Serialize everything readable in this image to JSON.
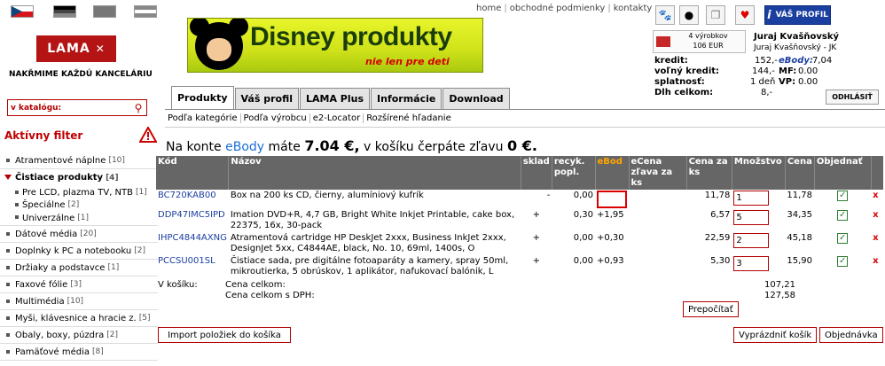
{
  "top_links": [
    "home",
    "obchodné podmienky",
    "kontakty"
  ],
  "tagline": "NAKŘMIME KAŽDÚ KANCELÁRIU",
  "logo_text": "LAMA",
  "banner": {
    "title": "Disney produkty",
    "subtitle": "nie len pre deti"
  },
  "user": {
    "profile_button": "VÁŠ PROFIL",
    "cart_line1": "4 výrobkov",
    "cart_line2": "106 EUR",
    "name": "Juraj Kvašňovský",
    "company": "Juraj Kvašňovský - JK",
    "logout": "ODHLÁSIŤ"
  },
  "account": [
    {
      "label": "kredit:",
      "value": "152,-",
      "label2": "eBody:",
      "value2": "7,04"
    },
    {
      "label": "voľný kredit:",
      "value": "144,-",
      "label2": "MF:",
      "value2": "0.00"
    },
    {
      "label": "splatnosť:",
      "value": "1 deň",
      "label2": "VP:",
      "value2": "0.00"
    },
    {
      "label": "Dlh celkom:",
      "value": "8,-",
      "label2": "",
      "value2": ""
    }
  ],
  "tabs": [
    "Produkty",
    "Váš profil",
    "LAMA Plus",
    "Informácie",
    "Download"
  ],
  "subnav": [
    "Podľa kategórie",
    "Podľa výrobcu",
    "e2-Locator",
    "Rozšírené hľadanie"
  ],
  "search_label": "v katalógu:",
  "filter_heading": "Aktívny filter",
  "categories": [
    {
      "label": "Atramentové náplne",
      "count": "[10]"
    },
    {
      "label": "Čistiace produkty",
      "count": "[4]"
    },
    {
      "label": "Pre LCD, plazma TV, NTB",
      "count": "[1]"
    },
    {
      "label": "Špeciálne",
      "count": "[2]"
    },
    {
      "label": "Univerzálne",
      "count": "[1]"
    },
    {
      "label": "Dátové média",
      "count": "[20]"
    },
    {
      "label": "Doplnky k PC a notebooku",
      "count": "[2]"
    },
    {
      "label": "Držiaky a podstavce",
      "count": "[1]"
    },
    {
      "label": "Faxové fólie",
      "count": "[3]"
    },
    {
      "label": "Multimédia",
      "count": "[10]"
    },
    {
      "label": "Myši, klávesnice a hracie z.",
      "count": "[5]"
    },
    {
      "label": "Obaly, boxy, púzdra",
      "count": "[2]"
    },
    {
      "label": "Pamäťové média",
      "count": "[8]"
    }
  ],
  "econto": {
    "pre": "Na konte",
    "brand": "eBody",
    "mid": "máte",
    "amount": "7.04 €,",
    "post": "v košíku čerpáte zľavu",
    "discount": "0 €."
  },
  "columns": [
    "Kód",
    "Názov",
    "sklad",
    "recyk. popl.",
    "eBod",
    "eCena zľava za ks",
    "Cena za ks",
    "Množstvo",
    "Cena",
    "Objednať"
  ],
  "rows": [
    {
      "code": "BC720KAB00",
      "name": "Box na 200 ks CD, čierny, alumíniový kufrík",
      "stock": "-",
      "recycle": "0,00",
      "ebod": "",
      "price": "11,78",
      "qty": "1",
      "total": "11,78"
    },
    {
      "code": "DDP47IMC5IPD",
      "name": "Imation DVD+R, 4,7 GB, Bright White Inkjet Printable, cake box, 22375, 16x, 30-pack",
      "stock": "+",
      "recycle": "0,30",
      "ebod": "+1,95",
      "price": "6,57",
      "qty": "5",
      "total": "34,35"
    },
    {
      "code": "IHPC4844AXNG",
      "name": "Atramentová cartridge HP DeskJet 2xxx, Business InkJet 2xxx, DesignJet 5xx, C4844AE, black, No. 10, 69ml, 1400s, O",
      "stock": "+",
      "recycle": "0,00",
      "ebod": "+0,30",
      "price": "22,59",
      "qty": "2",
      "total": "45,18"
    },
    {
      "code": "PCCSU001SL",
      "name": "Čistiace sada, pre digitálne fotoaparáty a kamery, spray 50ml, mikroutierka, 5 obrúskov, 1 aplikátor, nafukovací balónik, L",
      "stock": "+",
      "recycle": "0,00",
      "ebod": "+0,93",
      "price": "5,30",
      "qty": "3",
      "total": "15,90"
    }
  ],
  "summary": {
    "label": "V košíku:",
    "total_label": "Cena celkom:",
    "total": "107,21",
    "vat_label": "Cena celkom s DPH:",
    "vat": "127,58"
  },
  "buttons": {
    "recalc": "Prepočítať",
    "import": "Import položiek do košíka",
    "empty": "Vyprázdniť košík",
    "order": "Objednávka"
  }
}
